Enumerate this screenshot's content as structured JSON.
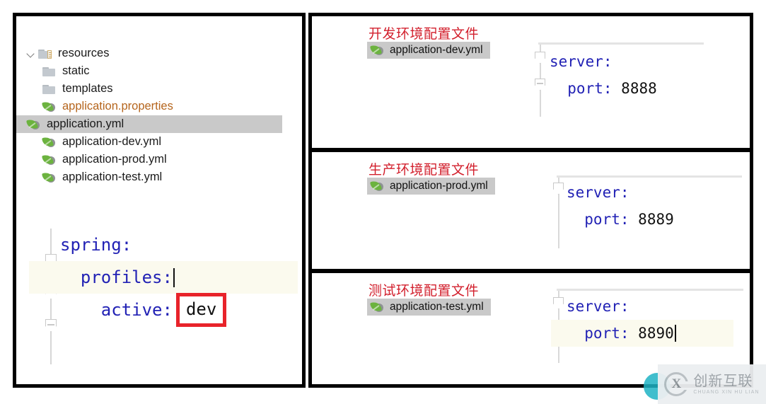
{
  "project_tree": {
    "name": "project-file-tree",
    "items": [
      {
        "label": "resources",
        "icon": "folder-resources-icon",
        "depth": 0,
        "expanded": true,
        "selected": false,
        "color": "dark"
      },
      {
        "label": "static",
        "icon": "folder-icon",
        "depth": 1,
        "expanded": false,
        "selected": false,
        "color": "dark"
      },
      {
        "label": "templates",
        "icon": "folder-icon",
        "depth": 1,
        "expanded": false,
        "selected": false,
        "color": "dark"
      },
      {
        "label": "application.properties",
        "icon": "spring-leaf-icon",
        "depth": 1,
        "expanded": false,
        "selected": false,
        "color": "orange"
      },
      {
        "label": "application.yml",
        "icon": "spring-leaf-icon",
        "depth": 1,
        "expanded": false,
        "selected": true,
        "color": "dark"
      },
      {
        "label": "application-dev.yml",
        "icon": "spring-leaf-icon",
        "depth": 1,
        "expanded": false,
        "selected": false,
        "color": "dark"
      },
      {
        "label": "application-prod.yml",
        "icon": "spring-leaf-icon",
        "depth": 1,
        "expanded": false,
        "selected": false,
        "color": "dark"
      },
      {
        "label": "application-test.yml",
        "icon": "spring-leaf-icon",
        "depth": 1,
        "expanded": false,
        "selected": false,
        "color": "dark"
      }
    ]
  },
  "main_editor": {
    "name": "application-yml-editor",
    "line1_key": "spring:",
    "line2_key": "  profiles:",
    "line3_key": "    active:",
    "line3_value": "dev",
    "ghost_line": "....  . . .  ... .. ..    ....."
  },
  "env_panels": [
    {
      "id": "dev",
      "heading": "开发环境配置文件",
      "file_label": "application-dev.yml",
      "code_line1": "server:",
      "code_key": "  port:",
      "code_value": "8888",
      "cursor": false,
      "highlight_port_line": false
    },
    {
      "id": "prod",
      "heading": "生产环境配置文件",
      "file_label": "application-prod.yml",
      "code_line1": "server:",
      "code_key": "  port:",
      "code_value": "8889",
      "cursor": false,
      "highlight_port_line": false
    },
    {
      "id": "test",
      "heading": "测试环境配置文件",
      "file_label": "application-test.yml",
      "code_line1": "server:",
      "code_key": "  port:",
      "code_value": "8890",
      "cursor": true,
      "highlight_port_line": true
    }
  ],
  "watermark": {
    "name": "site-watermark",
    "mark": "X",
    "chinese": "创新互联",
    "pinyin": "CHUANG XIN HU LIAN"
  },
  "colors": {
    "heading_red": "#d21f2c",
    "highlight_box_red": "#e8232a",
    "yaml_key_blue": "#2222b5",
    "properties_orange": "#b5651d",
    "selection_gray": "#c9c9c9",
    "line_highlight": "#fbfaee",
    "frame_black": "#000000"
  }
}
